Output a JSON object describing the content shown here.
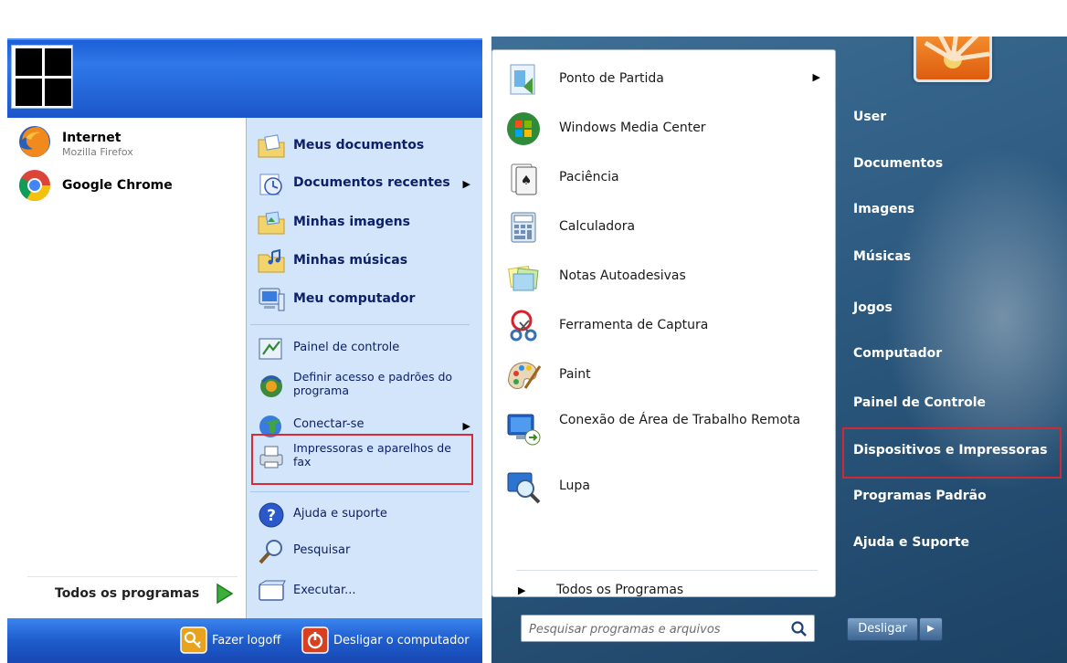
{
  "xp": {
    "pinned": [
      {
        "label": "Internet",
        "sublabel": "Mozilla Firefox",
        "icon": "firefox-icon"
      },
      {
        "label": "Google Chrome",
        "icon": "chrome-icon"
      }
    ],
    "all_programs": "Todos os programas",
    "right_items": [
      {
        "label": "Meus documentos",
        "icon": "folder-documents-icon"
      },
      {
        "label": "Documentos recentes",
        "icon": "recent-documents-icon"
      },
      {
        "label": "Minhas imagens",
        "icon": "folder-pictures-icon"
      },
      {
        "label": "Minhas músicas",
        "icon": "folder-music-icon"
      },
      {
        "label": "Meu computador",
        "icon": "my-computer-icon"
      },
      {
        "label": "Painel de controle",
        "icon": "control-panel-icon"
      },
      {
        "label": "Definir acesso e padrões do programa",
        "icon": "program-defaults-icon"
      },
      {
        "label": "Conectar-se",
        "icon": "connect-globe-icon"
      },
      {
        "label": "Impressoras e aparelhos de fax",
        "icon": "printer-fax-icon"
      },
      {
        "label": "Ajuda e suporte",
        "icon": "help-icon"
      },
      {
        "label": "Pesquisar",
        "icon": "search-icon"
      },
      {
        "label": "Executar...",
        "icon": "run-icon"
      }
    ],
    "footer": {
      "logoff": "Fazer logoff",
      "shutdown": "Desligar o computador"
    },
    "highlight_color": "#d72b35"
  },
  "w7": {
    "programs": [
      {
        "label": "Ponto de Partida",
        "icon": "getting-started-icon"
      },
      {
        "label": "Windows Media Center",
        "icon": "media-center-icon"
      },
      {
        "label": "Paciência",
        "icon": "solitaire-icon"
      },
      {
        "label": "Calculadora",
        "icon": "calculator-icon"
      },
      {
        "label": "Notas Autoadesivas",
        "icon": "sticky-notes-icon"
      },
      {
        "label": "Ferramenta de Captura",
        "icon": "snipping-tool-icon"
      },
      {
        "label": "Paint",
        "icon": "paint-icon"
      },
      {
        "label": "Conexão de Área de Trabalho Remota",
        "icon": "remote-desktop-icon"
      },
      {
        "label": "Lupa",
        "icon": "magnifier-icon"
      }
    ],
    "all_programs": "Todos os Programas",
    "search_placeholder": "Pesquisar programas e arquivos",
    "links": [
      "User",
      "Documentos",
      "Imagens",
      "Músicas",
      "Jogos",
      "Computador",
      "Painel de Controle",
      "Dispositivos e Impressoras",
      "Programas Padrão",
      "Ajuda e Suporte"
    ],
    "shutdown": "Desligar",
    "highlight_color": "#cf2a33"
  }
}
